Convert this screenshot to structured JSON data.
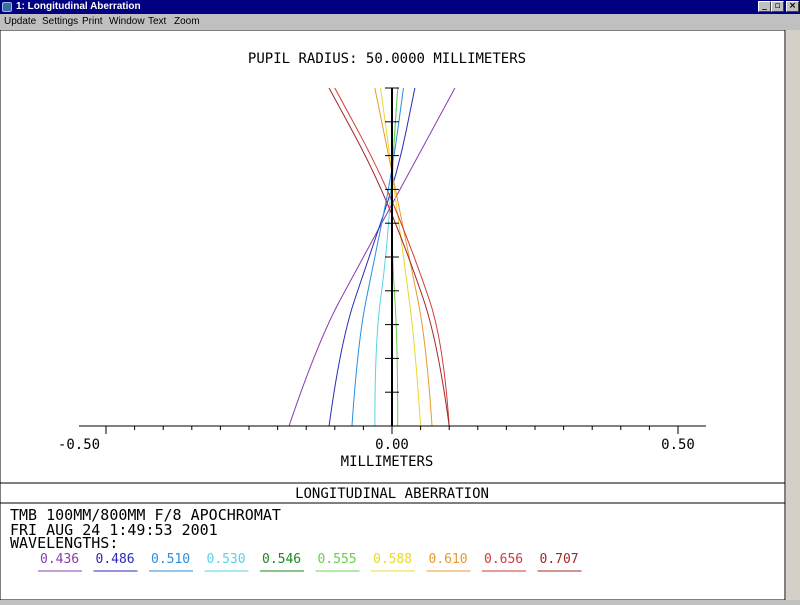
{
  "window": {
    "title": "1: Longitudinal Aberration"
  },
  "menu": [
    "Update",
    "Settings",
    "Print",
    "Window",
    "Text",
    "Zoom"
  ],
  "plot": {
    "pupil_label": "PUPIL RADIUS: 50.0000 MILLIMETERS",
    "x_ticks": [
      "-0.50",
      "0.00",
      "0.50"
    ],
    "x_label": "MILLIMETERS"
  },
  "info": {
    "heading": "LONGITUDINAL ABERRATION",
    "line1": "TMB 100MM/800MM F/8 APOCHROMAT",
    "line2": "FRI AUG 24 1:49:53 2001",
    "line3": "WAVELENGTHS:",
    "wavelengths": [
      "0.436",
      "0.486",
      "0.510",
      "0.530",
      "0.546",
      "0.555",
      "0.588",
      "0.610",
      "0.656",
      "0.707"
    ]
  },
  "colors": {
    "titlebar": "#000080",
    "axis": "#000000",
    "series": [
      "#8a3cb0",
      "#2a2ab8",
      "#2a8ee0",
      "#5ad2e8",
      "#1a8a1a",
      "#6ad04a",
      "#e8d830",
      "#e89a30",
      "#d43a3a",
      "#a02828"
    ]
  },
  "chart_data": {
    "type": "line",
    "title": "PUPIL RADIUS: 50.0000 MILLIMETERS",
    "xlabel": "MILLIMETERS",
    "ylabel": "",
    "xlim": [
      -0.5,
      0.5
    ],
    "ylim": [
      0,
      1
    ],
    "series": [
      {
        "name": "0.436",
        "x": [
          -0.18,
          -0.13,
          -0.05,
          0.03,
          0.11
        ],
        "y": [
          0,
          0.25,
          0.5,
          0.75,
          1
        ]
      },
      {
        "name": "0.486",
        "x": [
          -0.11,
          -0.09,
          -0.04,
          0.01,
          0.04
        ],
        "y": [
          0,
          0.25,
          0.5,
          0.75,
          1
        ]
      },
      {
        "name": "0.510",
        "x": [
          -0.07,
          -0.06,
          -0.03,
          0.0,
          0.02
        ],
        "y": [
          0,
          0.25,
          0.5,
          0.75,
          1
        ]
      },
      {
        "name": "0.530",
        "x": [
          -0.03,
          -0.03,
          -0.01,
          0.0,
          0.01
        ],
        "y": [
          0,
          0.25,
          0.5,
          0.75,
          1
        ]
      },
      {
        "name": "0.546",
        "x": [
          0.0,
          0.0,
          0.0,
          0.0,
          0.0
        ],
        "y": [
          0,
          0.25,
          0.5,
          0.75,
          1
        ]
      },
      {
        "name": "0.555",
        "x": [
          0.01,
          0.01,
          0.0,
          0.0,
          0.01
        ],
        "y": [
          0,
          0.25,
          0.5,
          0.75,
          1
        ]
      },
      {
        "name": "0.588",
        "x": [
          0.05,
          0.04,
          0.02,
          0.0,
          -0.02
        ],
        "y": [
          0,
          0.25,
          0.5,
          0.75,
          1
        ]
      },
      {
        "name": "0.610",
        "x": [
          0.07,
          0.06,
          0.03,
          0.0,
          -0.03
        ],
        "y": [
          0,
          0.25,
          0.5,
          0.75,
          1
        ]
      },
      {
        "name": "0.656",
        "x": [
          0.1,
          0.09,
          0.04,
          -0.02,
          -0.1
        ],
        "y": [
          0,
          0.25,
          0.5,
          0.75,
          1
        ]
      },
      {
        "name": "0.707",
        "x": [
          0.1,
          0.08,
          0.03,
          -0.03,
          -0.11
        ],
        "y": [
          0,
          0.25,
          0.5,
          0.75,
          1
        ]
      }
    ]
  }
}
